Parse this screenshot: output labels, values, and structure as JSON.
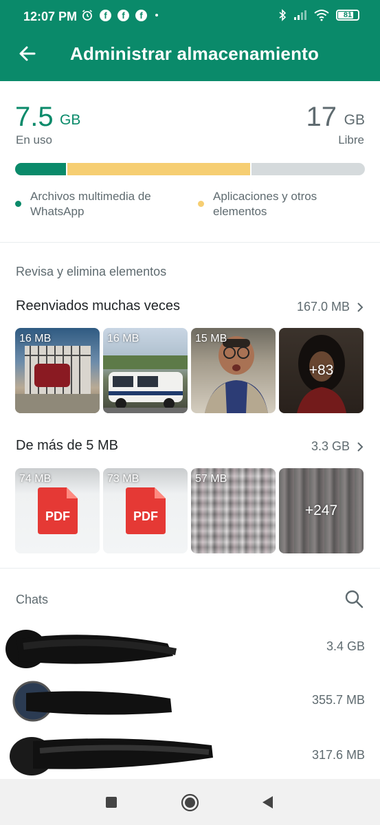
{
  "status_bar": {
    "time": "12:07 PM",
    "battery": "81",
    "battery_level": 0.81,
    "icons": [
      "alarm-icon",
      "facebook-icon",
      "facebook-icon",
      "facebook-icon",
      "dot-icon",
      "bluetooth-icon",
      "signal-icon",
      "wifi-icon",
      "battery-icon"
    ]
  },
  "header": {
    "title": "Administrar almacenamiento",
    "back_icon": "arrow-left-icon"
  },
  "storage": {
    "used_value": "7.5",
    "used_unit": "GB",
    "used_label": "En uso",
    "free_value": "17",
    "free_unit": "GB",
    "free_label": "Libre",
    "bar": {
      "whatsapp_fraction": 0.145,
      "apps_fraction": 0.53,
      "whatsapp_color": "#0a8a6a",
      "apps_color": "#f6ce72",
      "free_color": "#d5dadc"
    },
    "legend": [
      {
        "label": "Archivos multimedia de WhatsApp",
        "color": "#0a8a6a"
      },
      {
        "label": "Aplicaciones y otros elementos",
        "color": "#f6ce72"
      }
    ]
  },
  "review": {
    "title": "Revisa y elimina elementos",
    "forwarded": {
      "label": "Reenviados muchas veces",
      "size": "167.0 MB",
      "items": [
        {
          "size": "16 MB"
        },
        {
          "size": "16 MB"
        },
        {
          "size": "15 MB"
        },
        {
          "more": "+83"
        }
      ]
    },
    "large": {
      "label": "De más de 5 MB",
      "size": "3.3 GB",
      "items": [
        {
          "size": "74 MB",
          "type": "PDF"
        },
        {
          "size": "73 MB",
          "type": "PDF"
        },
        {
          "size": "57 MB"
        },
        {
          "more": "+247"
        }
      ]
    }
  },
  "chats": {
    "title": "Chats",
    "search_icon": "search-icon",
    "items": [
      {
        "size": "3.4 GB"
      },
      {
        "size": "355.7 MB"
      },
      {
        "size": "317.6 MB"
      }
    ]
  },
  "nav": {
    "icons": [
      "recents-square-icon",
      "home-circle-icon",
      "back-triangle-icon"
    ]
  }
}
